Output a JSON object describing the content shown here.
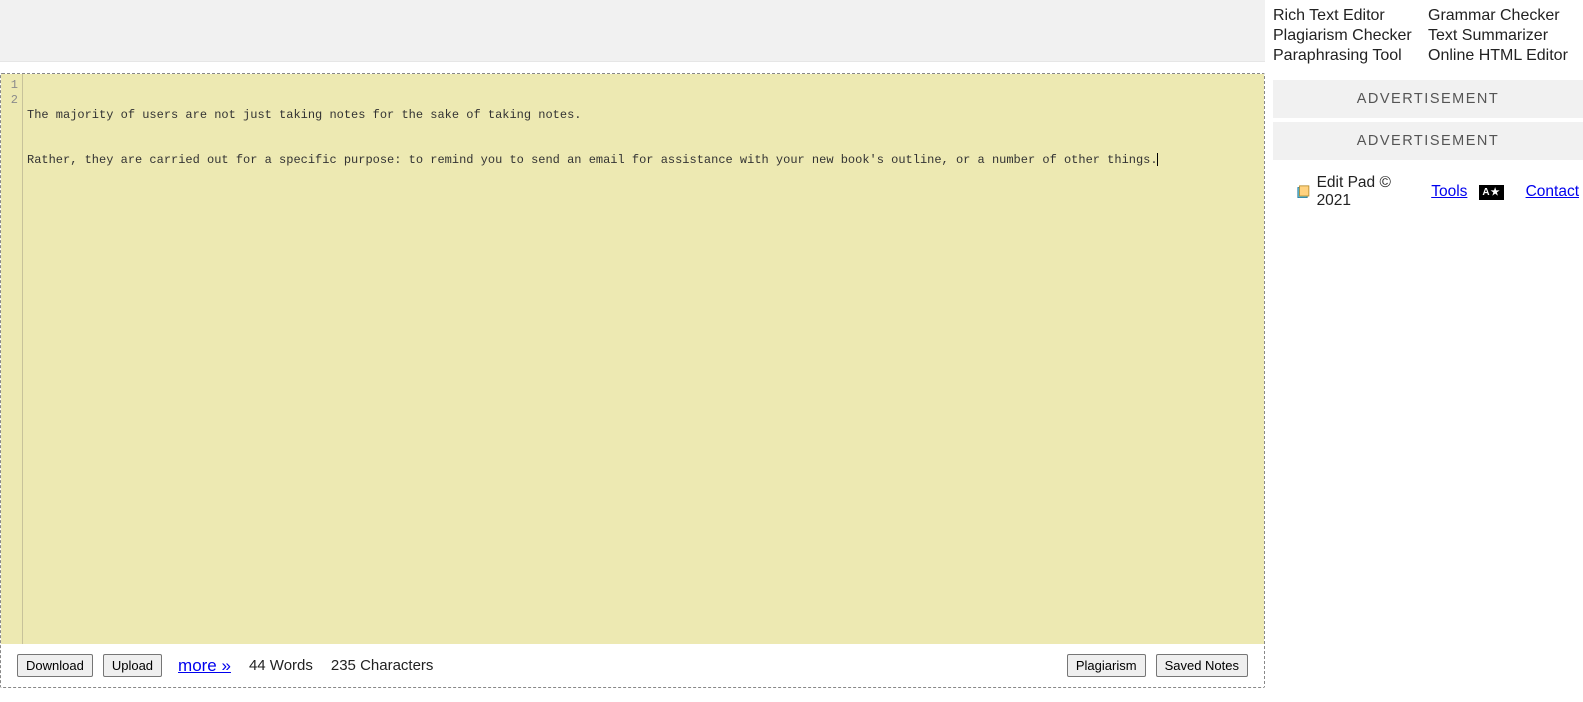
{
  "editor": {
    "lines": [
      "The majority of users are not just taking notes for the sake of taking notes.",
      "Rather, they are carried out for a specific purpose: to remind you to send an email for assistance with your new book's outline, or a number of other things."
    ],
    "line_numbers": [
      "1",
      "2"
    ]
  },
  "footer": {
    "download": "Download",
    "upload": "Upload",
    "more": "more »",
    "words": "44 Words",
    "chars": "235 Characters",
    "plagiarism": "Plagiarism",
    "saved_notes": "Saved Notes"
  },
  "side_links": {
    "col1": [
      "Rich Text Editor",
      "Plagiarism Checker",
      "Paraphrasing Tool"
    ],
    "col2": [
      "Grammar Checker",
      "Text Summarizer",
      "Online HTML Editor"
    ]
  },
  "ads": {
    "label1": "ADVERTISEMENT",
    "label2": "ADVERTISEMENT"
  },
  "site": {
    "name": "Edit Pad © 2021",
    "tools": "Tools",
    "lang": "A|文",
    "contact": "Contact"
  }
}
